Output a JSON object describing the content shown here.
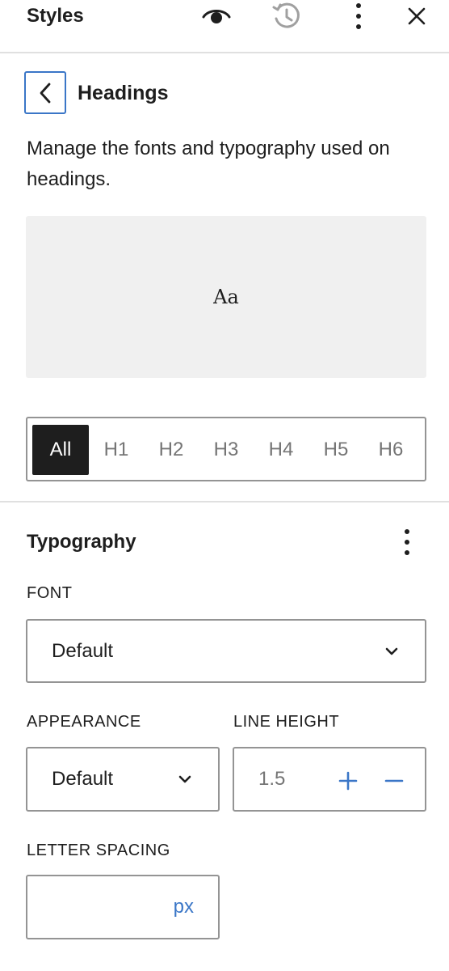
{
  "header": {
    "title": "Styles",
    "icons": [
      "eye-icon",
      "history-icon",
      "more-vertical-icon",
      "close-icon"
    ]
  },
  "panel": {
    "back_icon": "chevron-left-icon",
    "title": "Headings",
    "description": "Manage the fonts and typography used on headings.",
    "preview_text": "Aa"
  },
  "levels": {
    "items": [
      {
        "label": "All",
        "active": true
      },
      {
        "label": "H1",
        "active": false
      },
      {
        "label": "H2",
        "active": false
      },
      {
        "label": "H3",
        "active": false
      },
      {
        "label": "H4",
        "active": false
      },
      {
        "label": "H5",
        "active": false
      },
      {
        "label": "H6",
        "active": false
      }
    ]
  },
  "typography": {
    "title": "Typography",
    "font_label": "FONT",
    "font_value": "Default",
    "appearance_label": "APPEARANCE",
    "appearance_value": "Default",
    "line_height_label": "LINE HEIGHT",
    "line_height_value": "1.5",
    "letter_spacing_label": "LETTER SPACING",
    "letter_spacing_value": "",
    "letter_spacing_unit": "px"
  },
  "colors": {
    "accent": "#3a76c7",
    "active_bg": "#1e1e1e",
    "preview_bg": "#f0f0f0"
  }
}
